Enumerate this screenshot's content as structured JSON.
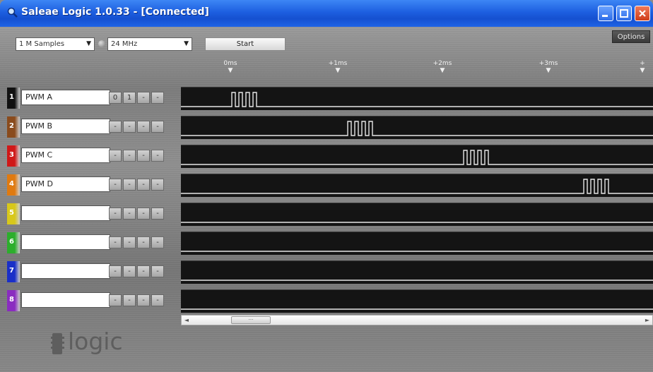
{
  "window": {
    "title": "Saleae Logic 1.0.33 - [Connected]",
    "colors": {
      "titlebar": "#1d5fe0",
      "close": "#cf3c18"
    }
  },
  "toolbar": {
    "samples_select": "1 M Samples",
    "rate_select": "24 MHz",
    "start_label": "Start",
    "options_label": "Options"
  },
  "timeline": {
    "ticks": [
      "0ms",
      "+1ms",
      "+2ms",
      "+3ms",
      "+"
    ]
  },
  "channels": [
    {
      "number": "1",
      "name": "PWM A",
      "buttons": [
        "0",
        "1",
        "-",
        "-"
      ],
      "color": "#111111"
    },
    {
      "number": "2",
      "name": "PWM B",
      "buttons": [
        "-",
        "-",
        "-",
        "-"
      ],
      "color": "#8a4b1c"
    },
    {
      "number": "3",
      "name": "PWM C",
      "buttons": [
        "-",
        "-",
        "-",
        "-"
      ],
      "color": "#d01818"
    },
    {
      "number": "4",
      "name": "PWM D",
      "buttons": [
        "-",
        "-",
        "-",
        "-"
      ],
      "color": "#e07a10"
    },
    {
      "number": "5",
      "name": "",
      "buttons": [
        "-",
        "-",
        "-",
        "-"
      ],
      "color": "#d8c81a"
    },
    {
      "number": "6",
      "name": "",
      "buttons": [
        "-",
        "-",
        "-",
        "-"
      ],
      "color": "#2cae2c"
    },
    {
      "number": "7",
      "name": "",
      "buttons": [
        "-",
        "-",
        "-",
        "-"
      ],
      "color": "#1a2fc8"
    },
    {
      "number": "8",
      "name": "",
      "buttons": [
        "-",
        "-",
        "-",
        "-"
      ],
      "color": "#8a2cc0"
    }
  ],
  "scrollbar": {
    "thumb_glyph": "···"
  },
  "brand": {
    "logo_text": "logic"
  }
}
